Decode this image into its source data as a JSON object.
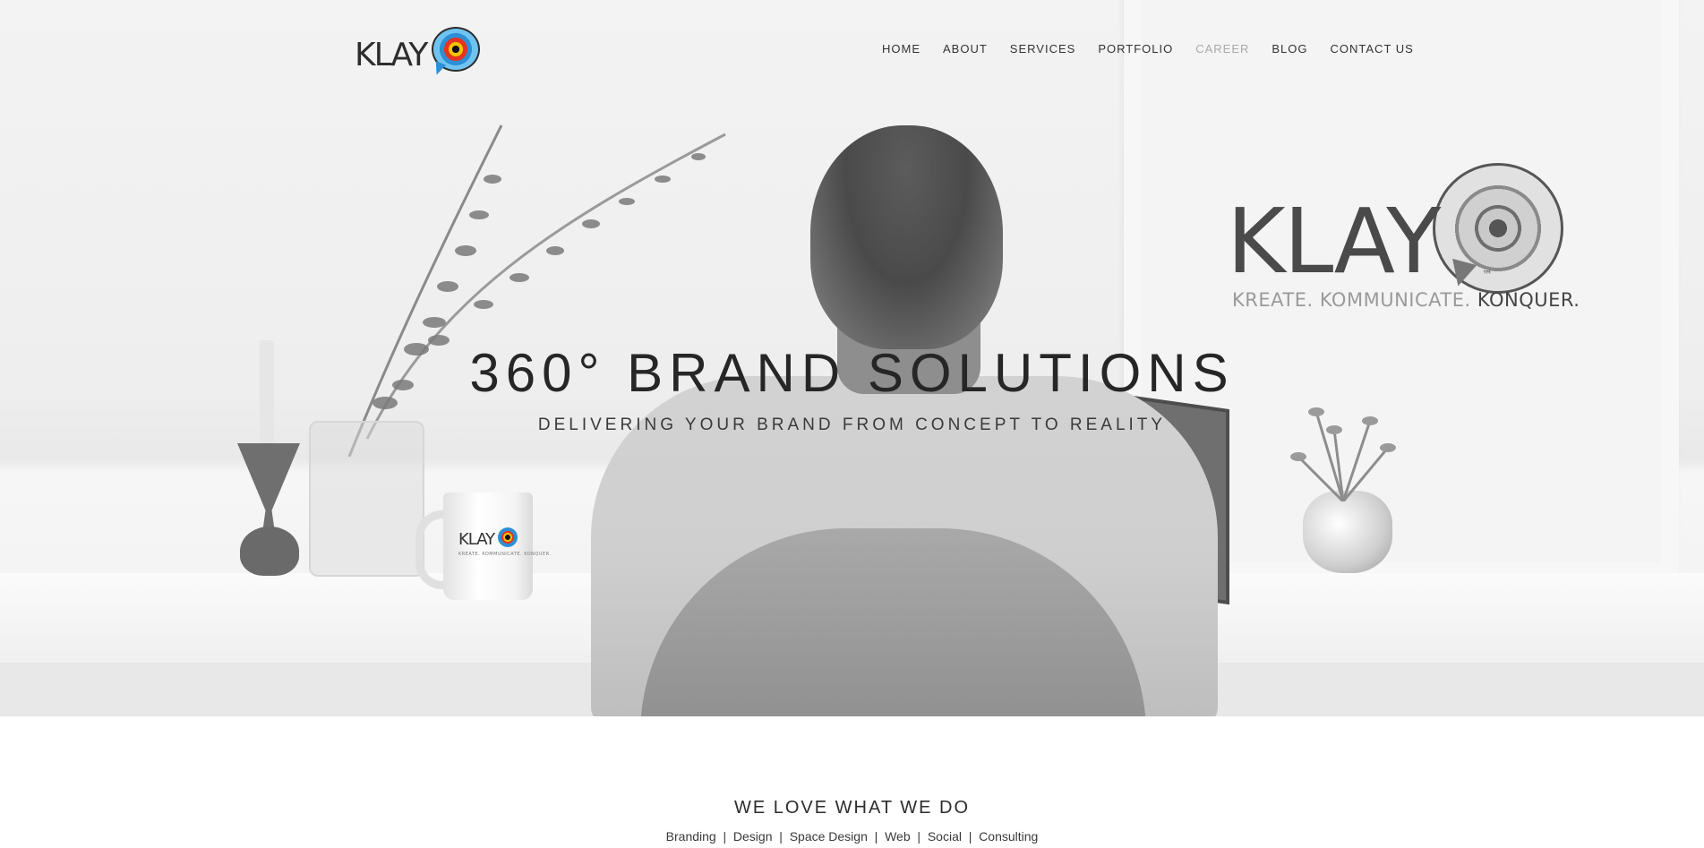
{
  "header": {
    "logo_text": "KLAY",
    "logo_tm": "™",
    "nav": [
      {
        "label": "HOME"
      },
      {
        "label": "ABOUT"
      },
      {
        "label": "SERVICES"
      },
      {
        "label": "PORTFOLIO"
      },
      {
        "label": "CAREER",
        "active": true
      },
      {
        "label": "BLOG"
      },
      {
        "label": "CONTACT US"
      }
    ]
  },
  "hero": {
    "title": "360° BRAND SOLUTIONS",
    "subtitle": "DELIVERING YOUR BRAND FROM CONCEPT TO REALITY",
    "poster": {
      "logo_text": "KLAY",
      "tm": "™",
      "tagline_light": "KREATE. KOMMUNICATE.",
      "tagline_dark": "KONQUER."
    },
    "mug": {
      "logo_text": "KLAY",
      "tagline": "KREATE. KOMMUNICATE. KONQUER."
    }
  },
  "intro": {
    "title": "WE LOVE WHAT WE DO",
    "services": [
      "Branding",
      "Design",
      "Space Design",
      "Web",
      "Social",
      "Consulting"
    ],
    "separator": "  |  "
  },
  "colors": {
    "text_dark": "#262626",
    "nav_active": "#aaaaaa",
    "logo_blue": "#2d8fd5",
    "logo_red": "#e63323",
    "logo_yellow": "#f5c400"
  }
}
